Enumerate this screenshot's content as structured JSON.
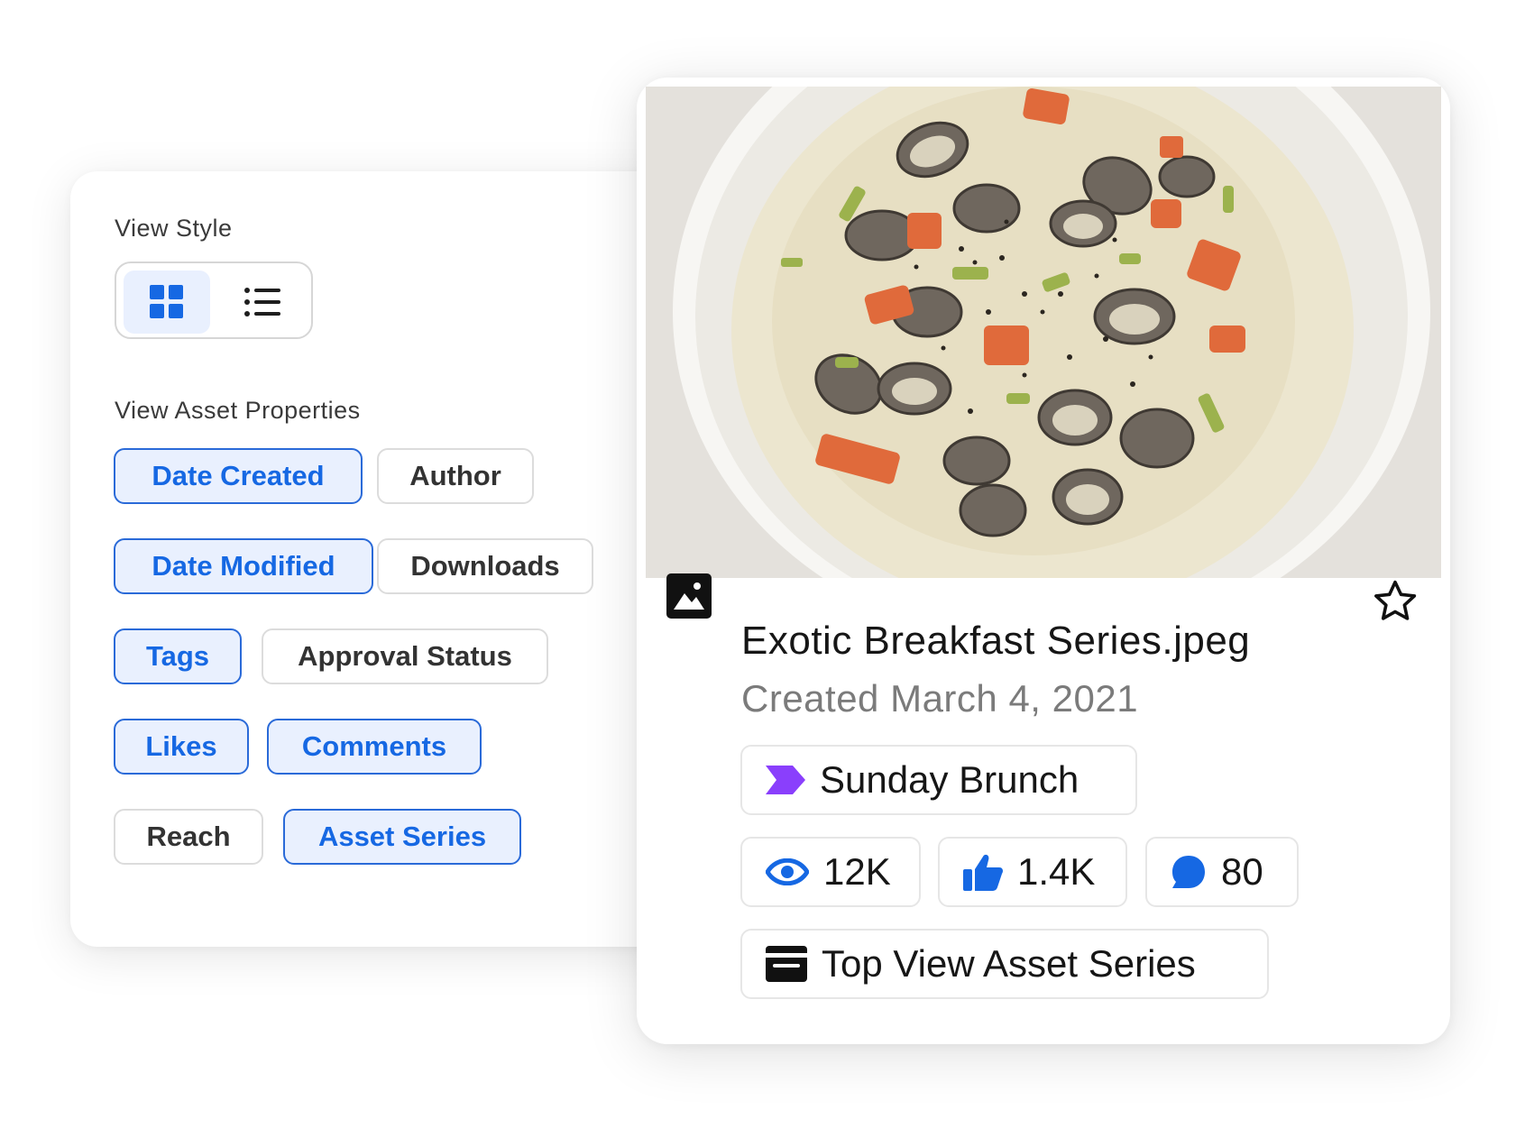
{
  "settings": {
    "view_style_label": "View Style",
    "view_asset_properties_label": "View Asset Properties",
    "properties": [
      {
        "label": "Date Created",
        "selected": true
      },
      {
        "label": "Author",
        "selected": false
      },
      {
        "label": "Date Modified",
        "selected": true
      },
      {
        "label": "Downloads",
        "selected": false
      },
      {
        "label": "Tags",
        "selected": true
      },
      {
        "label": "Approval Status",
        "selected": false
      },
      {
        "label": "Likes",
        "selected": true
      },
      {
        "label": "Comments",
        "selected": true
      },
      {
        "label": "Reach",
        "selected": false
      },
      {
        "label": "Asset Series",
        "selected": true
      }
    ],
    "selected_view": "grid"
  },
  "asset": {
    "file_name": "Exotic Breakfast Series.jpeg",
    "created": "Created March 4, 2021",
    "tag": "Sunday Brunch",
    "stats": {
      "views": "12K",
      "likes": "1.4K",
      "comments": "80"
    },
    "series": "Top View Asset Series"
  },
  "colors": {
    "accent": "#1668e3",
    "chip_selected_bg": "#e9f0fe",
    "tag_icon": "#8a3ffc"
  }
}
